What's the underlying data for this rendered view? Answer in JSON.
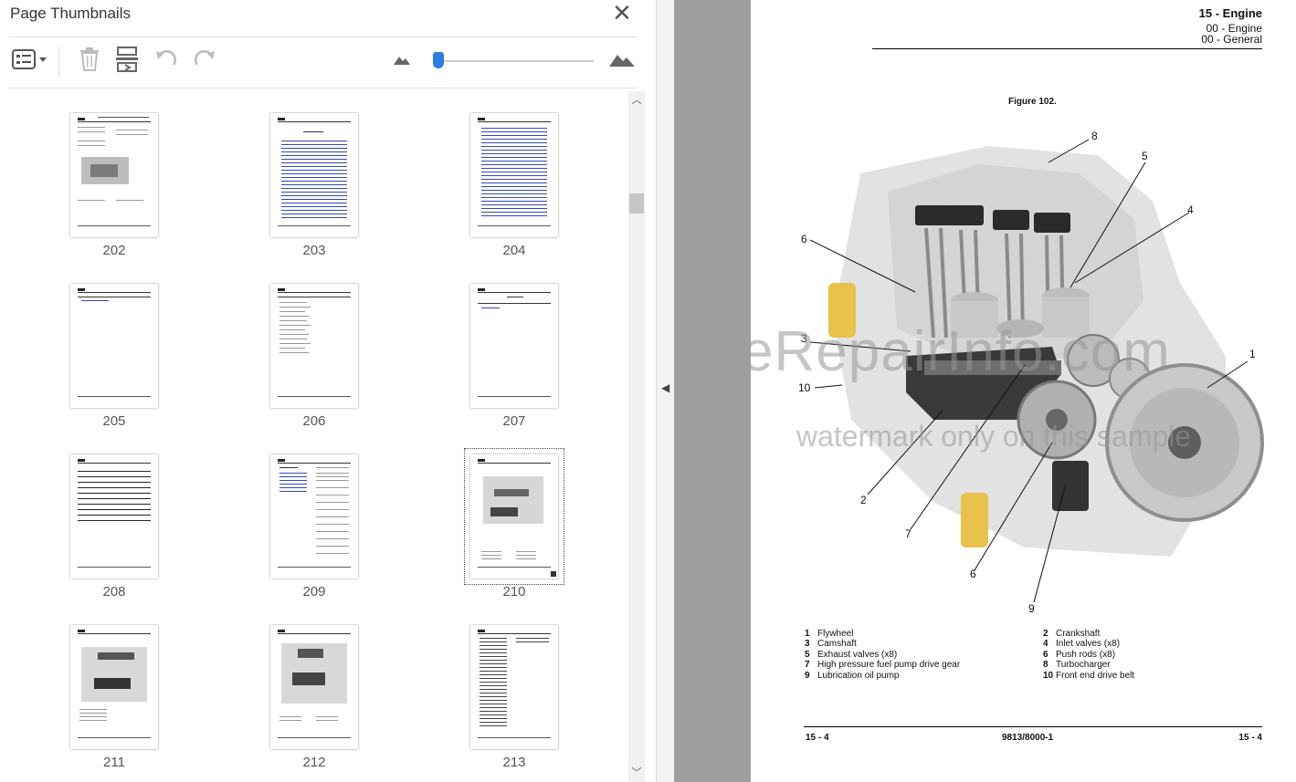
{
  "panel": {
    "title": "Page Thumbnails",
    "close_label": "✕",
    "toolbar": {
      "options_icon": "page-options-icon",
      "delete_icon": "trash-icon",
      "extract_icon": "extract-pages-icon",
      "rotate_ccw_icon": "rotate-counterclockwise-icon",
      "rotate_cw_icon": "rotate-clockwise-icon",
      "zoom_out_icon": "small-mountain-icon",
      "zoom_in_icon": "large-mountain-icon",
      "zoom_fraction": 0.0
    },
    "thumbnails": [
      {
        "page": "202"
      },
      {
        "page": "203"
      },
      {
        "page": "204"
      },
      {
        "page": "205"
      },
      {
        "page": "206"
      },
      {
        "page": "207"
      },
      {
        "page": "208"
      },
      {
        "page": "209"
      },
      {
        "page": "210",
        "selected": true
      },
      {
        "page": "211"
      },
      {
        "page": "212"
      },
      {
        "page": "213"
      }
    ]
  },
  "document": {
    "section_title": "15 - Engine",
    "section_sub1": "00 - Engine",
    "section_sub2": "00 - General",
    "figure_title": "Figure 102.",
    "callouts": [
      "8",
      "5",
      "4",
      "6",
      "3",
      "1",
      "10",
      "2",
      "7",
      "6",
      "9"
    ],
    "watermark_main": "eRepairInfo.com",
    "watermark_sub": "watermark only on this sample",
    "legend": [
      {
        "num": "1",
        "text": "Flywheel"
      },
      {
        "num": "2",
        "text": "Crankshaft"
      },
      {
        "num": "3",
        "text": "Camshaft"
      },
      {
        "num": "4",
        "text": "Inlet valves (x8)"
      },
      {
        "num": "5",
        "text": "Exhaust valves (x8)"
      },
      {
        "num": "6",
        "text": "Push rods (x8)"
      },
      {
        "num": "7",
        "text": "High pressure fuel pump drive gear"
      },
      {
        "num": "8",
        "text": "Turbocharger"
      },
      {
        "num": "9",
        "text": "Lubrication oil pump"
      },
      {
        "num": "10",
        "text": "Front end drive belt"
      }
    ],
    "footer_left": "15 - 4",
    "footer_mid": "9813/8000-1",
    "footer_right": "15 - 4"
  }
}
